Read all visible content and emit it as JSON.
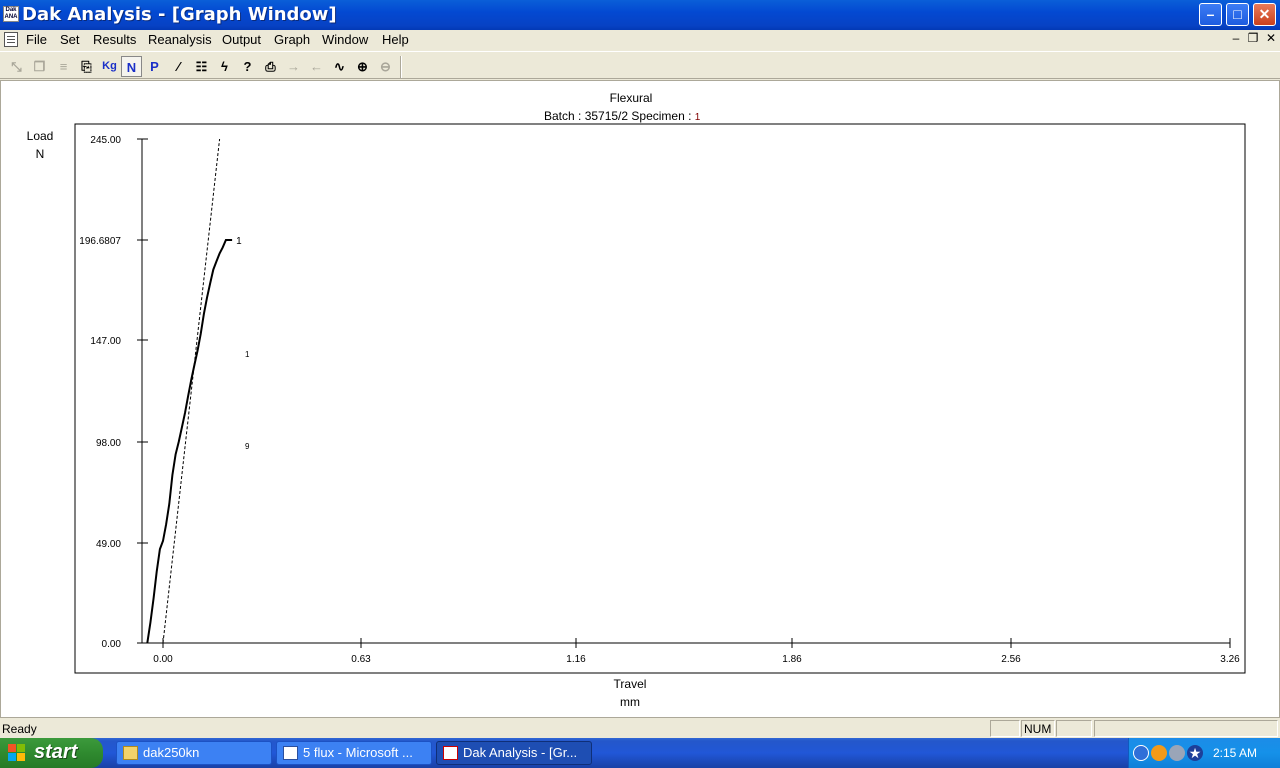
{
  "window": {
    "title": "Dak Analysis - [Graph Window]",
    "icon_text_top": "Dak",
    "icon_text_bottom": "ANA"
  },
  "title_buttons": {
    "minimize": "–",
    "maximize": "□",
    "close": "✕"
  },
  "menu": [
    "File",
    "Set",
    "Results",
    "Reanalysis",
    "Output",
    "Graph",
    "Window",
    "Help"
  ],
  "mdi_controls": {
    "minimize": "–",
    "restore": "❐",
    "close": "✕"
  },
  "toolbar": [
    {
      "icon": "zoom-graph-icon",
      "glyph": "⤡",
      "enabled": false
    },
    {
      "icon": "copy-graph-icon",
      "glyph": "❐",
      "enabled": false
    },
    {
      "icon": "align-icon",
      "glyph": "≡",
      "enabled": false
    },
    {
      "icon": "pages-icon",
      "glyph": "⎘",
      "enabled": true
    },
    {
      "icon": "kg-units-icon",
      "glyph": "Kg",
      "enabled": true
    },
    {
      "icon": "newton-units-icon",
      "glyph": "N",
      "enabled": true,
      "active": true
    },
    {
      "icon": "p-units-icon",
      "glyph": "P",
      "enabled": true
    },
    {
      "icon": "curve-icon",
      "glyph": "∕",
      "enabled": true
    },
    {
      "icon": "calc-icon",
      "glyph": "☷",
      "enabled": true
    },
    {
      "icon": "lightning-icon",
      "glyph": "ϟ",
      "enabled": true
    },
    {
      "icon": "help-pointer-icon",
      "glyph": "?",
      "enabled": true
    },
    {
      "icon": "print-icon",
      "glyph": "⎙",
      "enabled": true
    },
    {
      "icon": "arrow-right-icon",
      "glyph": "→",
      "enabled": false
    },
    {
      "icon": "arrow-left-icon",
      "glyph": "←",
      "enabled": false
    },
    {
      "icon": "overlay-curves-icon",
      "glyph": "∿",
      "enabled": true
    },
    {
      "icon": "zoom-in-icon",
      "glyph": "⊕",
      "enabled": true
    },
    {
      "icon": "zoom-out-icon",
      "glyph": "⊖",
      "enabled": false
    }
  ],
  "chart_data": {
    "type": "line",
    "title": "Flexural",
    "subtitle_prefix": "Batch : 35715/2 Specimen : ",
    "subtitle_specimen": "1",
    "ylabel": "Load",
    "yunit": "N",
    "xlabel": "Travel",
    "xunit": "mm",
    "yticks": [
      "0.00",
      "49.00",
      "98.00",
      "147.00",
      "196.6807",
      "245.00"
    ],
    "ytick_values": [
      0,
      49,
      98,
      147,
      196.6807,
      245
    ],
    "xticks": [
      "0.00",
      "0.63",
      "1.16",
      "1.86",
      "2.56",
      "3.26"
    ],
    "xtick_values": [
      0,
      0.63,
      1.16,
      1.86,
      2.56,
      3.26
    ],
    "ylim": [
      0,
      245
    ],
    "series": [
      {
        "name": "1",
        "style": "solid",
        "x": [
          -0.05,
          -0.04,
          -0.03,
          -0.02,
          -0.01,
          0.0,
          0.01,
          0.02,
          0.03,
          0.04,
          0.05,
          0.06,
          0.07,
          0.08,
          0.09,
          0.1,
          0.11,
          0.12,
          0.13,
          0.14,
          0.15,
          0.16,
          0.17,
          0.18,
          0.19,
          0.2,
          0.21,
          0.22
        ],
        "y": [
          0,
          10,
          22,
          35,
          46,
          50,
          58,
          68,
          82,
          92,
          98,
          105,
          112,
          120,
          128,
          135,
          142,
          150,
          160,
          168,
          175,
          182,
          186,
          190,
          193,
          196.6807,
          196.6807,
          196.6807
        ]
      },
      {
        "style": "dashed",
        "x": [
          0.0,
          0.18
        ],
        "y": [
          0,
          245
        ]
      }
    ],
    "stray_marks": [
      "1",
      "9"
    ]
  },
  "status": {
    "text": "Ready",
    "num": "NUM"
  },
  "taskbar": {
    "start": "start",
    "tasks": [
      {
        "label": "dak250kn",
        "icon": "folder-icon",
        "active": false
      },
      {
        "label": "5 flux - Microsoft ...",
        "icon": "word-doc-icon",
        "active": false
      },
      {
        "label": "Dak Analysis - [Gr...",
        "icon": "dak-app-icon",
        "active": true
      }
    ],
    "clock": "2:15 AM"
  }
}
